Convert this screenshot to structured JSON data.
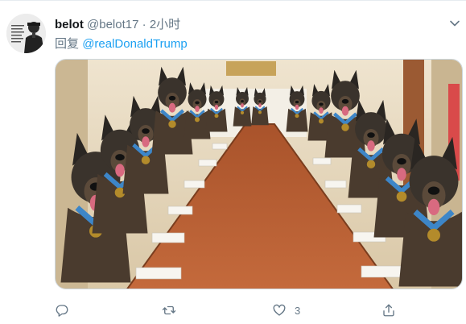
{
  "tweet": {
    "author_name": "belot",
    "author_handle": "@belot17",
    "separator": "·",
    "time": "2小时",
    "reply_prefix": "回复",
    "reply_mention": "@realDonaldTrump",
    "like_count": "3"
  },
  "icons": {
    "caret": "chevron-down-icon",
    "reply": "reply-icon",
    "retweet": "retweet-icon",
    "like": "heart-icon",
    "share": "share-icon"
  },
  "colors": {
    "link": "#1da1f2",
    "muted": "#657786",
    "text": "#14171a",
    "border": "#e6ecf0"
  }
}
